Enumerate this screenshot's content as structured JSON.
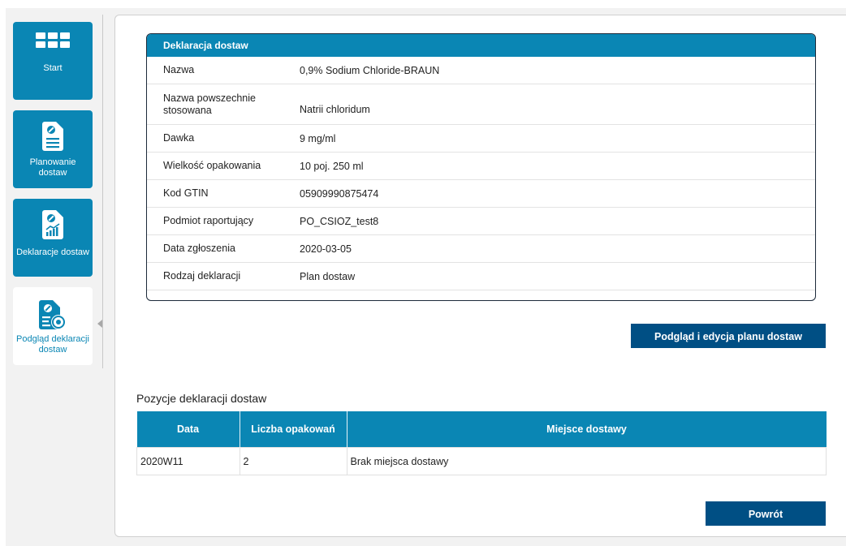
{
  "sidebar": {
    "items": [
      {
        "label": "Start",
        "icon": "grid-icon"
      },
      {
        "label": "Planowanie dostaw",
        "icon": "document-pill-icon"
      },
      {
        "label": "Deklaracje dostaw",
        "icon": "document-chart-icon"
      },
      {
        "label": "Podgląd deklaracji dostaw",
        "icon": "document-view-icon",
        "active": true
      }
    ]
  },
  "declaration": {
    "title": "Deklaracja dostaw",
    "rows": [
      {
        "label": "Nazwa",
        "value": "0,9% Sodium Chloride-BRAUN"
      },
      {
        "label": "Nazwa powszechnie stosowana",
        "value": "Natrii chloridum"
      },
      {
        "label": "Dawka",
        "value": "9 mg/ml"
      },
      {
        "label": "Wielkość opakowania",
        "value": "10 poj. 250 ml"
      },
      {
        "label": "Kod GTIN",
        "value": "05909990875474"
      },
      {
        "label": "Podmiot raportujący",
        "value": "PO_CSIOZ_test8"
      },
      {
        "label": "Data zgłoszenia",
        "value": "2020-03-05"
      },
      {
        "label": "Rodzaj deklaracji",
        "value": "Plan dostaw"
      }
    ]
  },
  "buttons": {
    "edit_label": "Podgląd i edycja planu dostaw",
    "back_label": "Powrót"
  },
  "positions": {
    "title": "Pozycje deklaracji dostaw",
    "columns": [
      "Data",
      "Liczba opakowań",
      "Miejsce dostawy"
    ],
    "rows": [
      [
        "2020W11",
        "2",
        "Brak miejsca dostawy"
      ]
    ]
  },
  "colors": {
    "accent": "#0a86b4",
    "button": "#004f84"
  }
}
